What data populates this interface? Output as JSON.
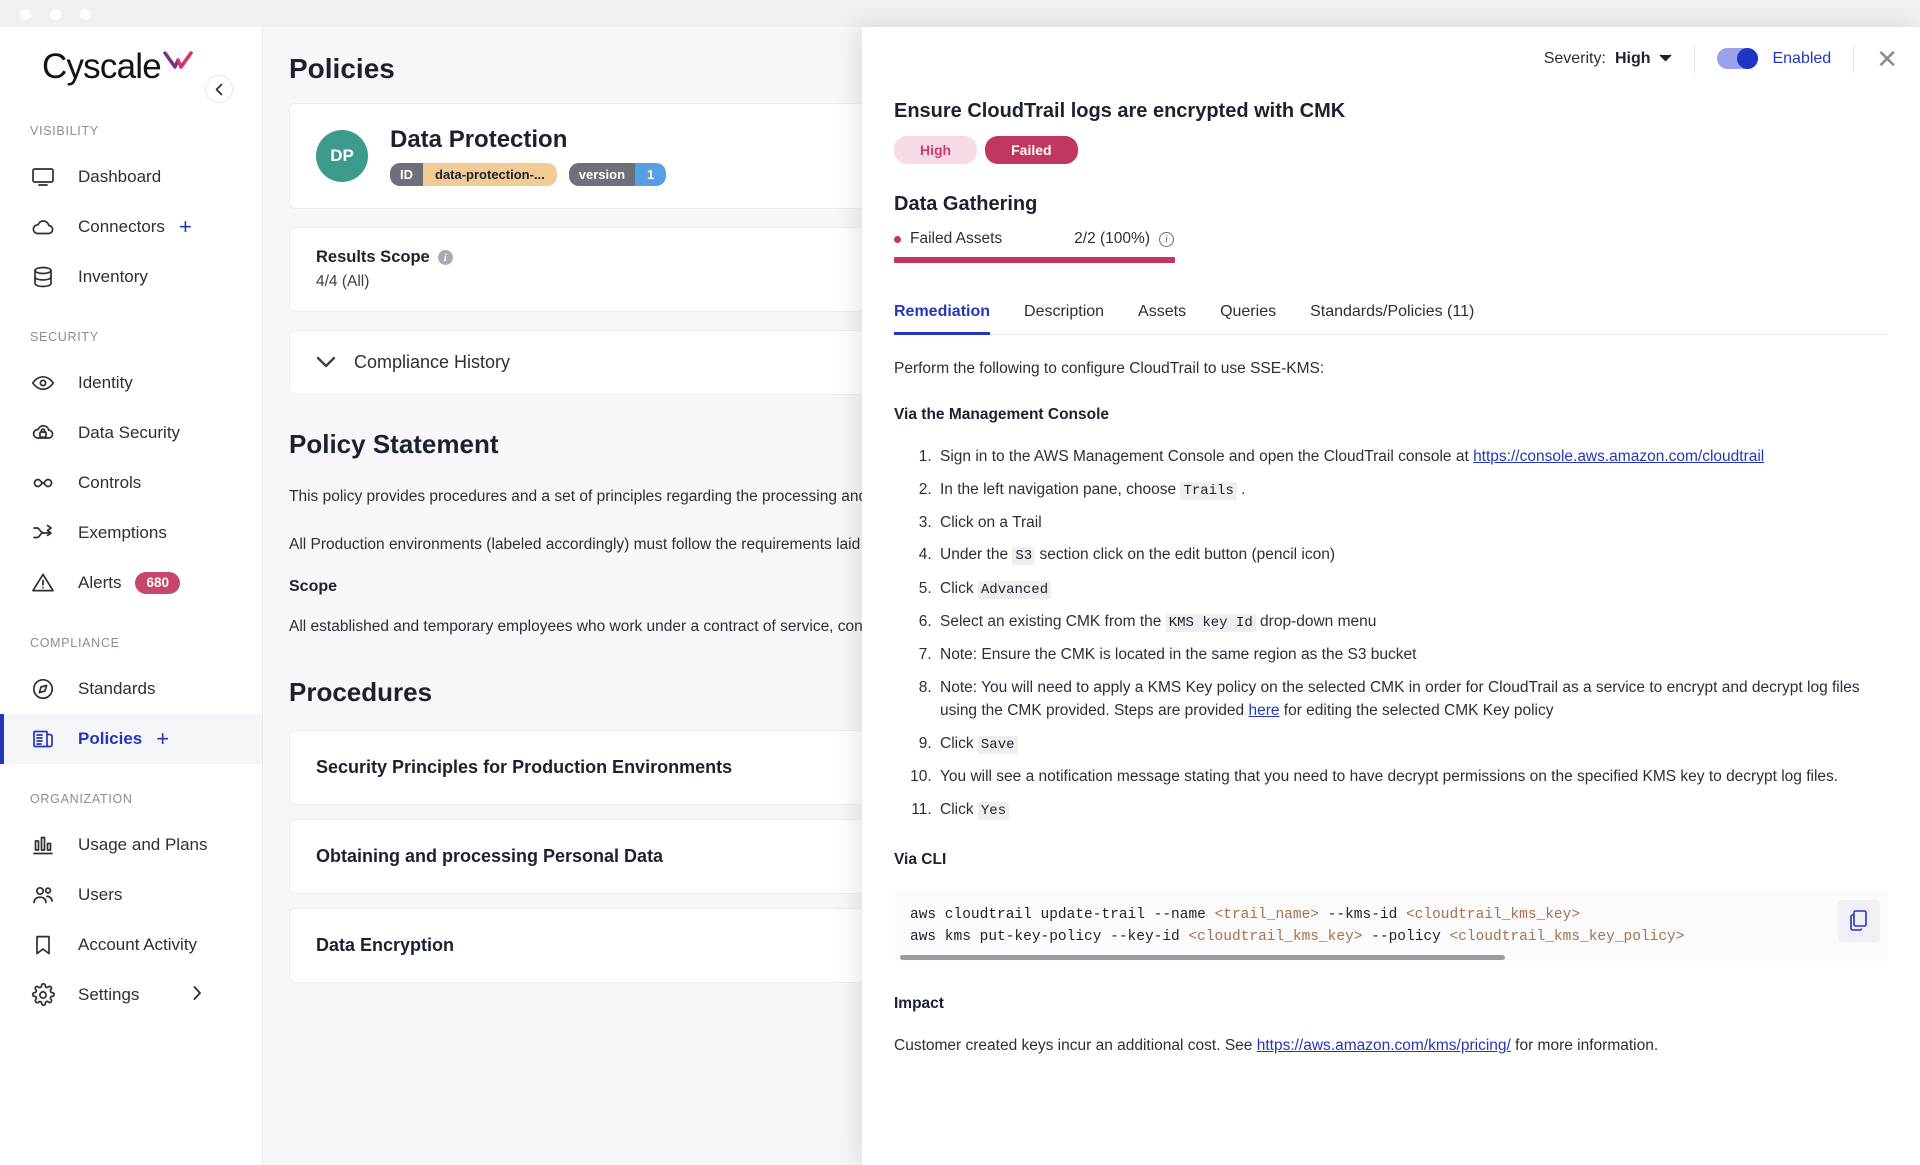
{
  "window": {
    "dots": [
      "red",
      "yellow",
      "green"
    ]
  },
  "brand": {
    "name": "Cyscale"
  },
  "sidebar": {
    "collapse_icon": "chevron-left-icon",
    "groups": [
      {
        "label": "VISIBILITY",
        "items": [
          {
            "label": "Dashboard",
            "icon": "monitor-icon",
            "plus": false,
            "active": false
          },
          {
            "label": "Connectors",
            "icon": "cloud-icon",
            "plus": true,
            "active": false
          },
          {
            "label": "Inventory",
            "icon": "database-icon",
            "plus": false,
            "active": false
          }
        ]
      },
      {
        "label": "SECURITY",
        "items": [
          {
            "label": "Identity",
            "icon": "eye-icon",
            "plus": false,
            "active": false
          },
          {
            "label": "Data Security",
            "icon": "cloud-lock-icon",
            "plus": false,
            "active": false
          },
          {
            "label": "Controls",
            "icon": "infinity-icon",
            "plus": false,
            "active": false
          },
          {
            "label": "Exemptions",
            "icon": "shuffle-icon",
            "plus": false,
            "active": false
          },
          {
            "label": "Alerts",
            "icon": "warning-triangle-icon",
            "plus": false,
            "active": false,
            "badge": "680"
          }
        ]
      },
      {
        "label": "COMPLIANCE",
        "items": [
          {
            "label": "Standards",
            "icon": "compass-icon",
            "plus": false,
            "active": false
          },
          {
            "label": "Policies",
            "icon": "document-icon",
            "plus": true,
            "active": true
          }
        ]
      },
      {
        "label": "ORGANIZATION",
        "items": [
          {
            "label": "Usage and Plans",
            "icon": "bar-chart-icon",
            "plus": false,
            "active": false
          },
          {
            "label": "Users",
            "icon": "users-icon",
            "plus": false,
            "active": false
          },
          {
            "label": "Account Activity",
            "icon": "bookmark-icon",
            "plus": false,
            "active": false
          },
          {
            "label": "Settings",
            "icon": "gear-icon",
            "plus": false,
            "active": false,
            "chevron": "›"
          }
        ]
      }
    ]
  },
  "main": {
    "page_title": "Policies",
    "policy": {
      "initials": "DP",
      "name": "Data Protection",
      "id_key": "ID",
      "id_value": "data-protection-...",
      "version_key": "version",
      "version_value": "1"
    },
    "results_scope": {
      "title": "Results Scope",
      "value": "4/4 (All)",
      "info_icon": "info-icon",
      "chevron_icon": "chevron-down-icon"
    },
    "compliance_history": {
      "label": "Compliance History",
      "chevron_icon": "chevron-down-icon"
    },
    "policy_statement": {
      "heading": "Policy Statement",
      "paragraph1": "This policy provides procedures and a set of principles regarding the processing and protection of data, on Cloud and on premise. Cyscale takes data confidentiality, integrity, and availability for employees and customers very seriously.",
      "paragraph2": "All Production environments (labeled accordingly) must follow the requirements laid out in this policy.",
      "scope_heading": "Scope",
      "scope_paragraph": "All established and temporary employees who work under a contract of service, contractors and third parties that have access to any person or customer data stored in Cloud Systems, IT Systems, or in manual records."
    },
    "procedures": {
      "heading": "Procedures",
      "items": [
        "Security Principles for Production Environments",
        "Obtaining and processing Personal Data",
        "Data Encryption"
      ]
    }
  },
  "drawer": {
    "severity_label": "Severity:",
    "severity_value": "High",
    "severity_caret_icon": "chevron-down-icon",
    "toggle_label": "Enabled",
    "toggle_on": true,
    "close_icon": "close-icon",
    "finding_title": "Ensure CloudTrail logs are encrypted with CMK",
    "pill_severity": "High",
    "pill_status": "Failed",
    "data_gathering": {
      "heading": "Data Gathering",
      "row_label": "Failed Assets",
      "row_value": "2/2 (100%)",
      "info_icon": "info-icon",
      "bar_percent": 100
    },
    "tabs": [
      {
        "label": "Remediation",
        "active": true
      },
      {
        "label": "Description",
        "active": false
      },
      {
        "label": "Assets",
        "active": false
      },
      {
        "label": "Queries",
        "active": false
      },
      {
        "label": "Standards/Policies (11)",
        "active": false
      }
    ],
    "remediation": {
      "lead": "Perform the following to configure CloudTrail to use SSE-KMS:",
      "console_heading": "Via the Management Console",
      "steps": [
        {
          "pre": "Sign in to the AWS Management Console and open the CloudTrail console at ",
          "link": "https://console.aws.amazon.com/cloudtrail",
          "post": ""
        },
        {
          "pre": "In the left navigation pane, choose ",
          "code": "Trails",
          "post": " ."
        },
        {
          "pre": "Click on a Trail",
          "post": ""
        },
        {
          "pre": "Under the ",
          "code": "S3",
          "post": " section click on the edit button (pencil icon)"
        },
        {
          "pre": "Click ",
          "code": "Advanced",
          "post": ""
        },
        {
          "pre": "Select an existing CMK from the ",
          "code": "KMS key Id",
          "post": " drop-down menu"
        },
        {
          "pre": "Note: Ensure the CMK is located in the same region as the S3 bucket",
          "post": ""
        },
        {
          "pre": "Note: You will need to apply a KMS Key policy on the selected CMK in order for CloudTrail as a service to encrypt and decrypt log files using the CMK provided. Steps are provided ",
          "link": "here",
          "post": " for editing the selected CMK Key policy"
        },
        {
          "pre": "Click ",
          "code": "Save",
          "post": ""
        },
        {
          "pre": "You will see a notification message stating that you need to have decrypt permissions on the specified KMS key to decrypt log files.",
          "post": ""
        },
        {
          "pre": "Click ",
          "code": "Yes",
          "post": ""
        }
      ],
      "cli_heading": "Via CLI",
      "cli_line1_a": "aws cloudtrail update-trail --name ",
      "cli_line1_b": "<trail_name>",
      "cli_line1_c": " --kms-id ",
      "cli_line1_d": "<cloudtrail_kms_key>",
      "cli_line2_a": "aws kms put-key-policy --key-id ",
      "cli_line2_b": "<cloudtrail_kms_key>",
      "cli_line2_c": " --policy ",
      "cli_line2_d": "<cloudtrail_kms_key_policy>",
      "copy_icon": "copy-icon",
      "impact_heading": "Impact",
      "impact_pre": "Customer created keys incur an additional cost. See ",
      "impact_link": "https://aws.amazon.com/kms/pricing/",
      "impact_post": " for more information."
    }
  },
  "colors": {
    "accent": "#2536b8",
    "danger": "#c2375f",
    "avatar": "#3d9b8d",
    "id_chip": "#f0cc94",
    "version_chip": "#579fe3"
  }
}
